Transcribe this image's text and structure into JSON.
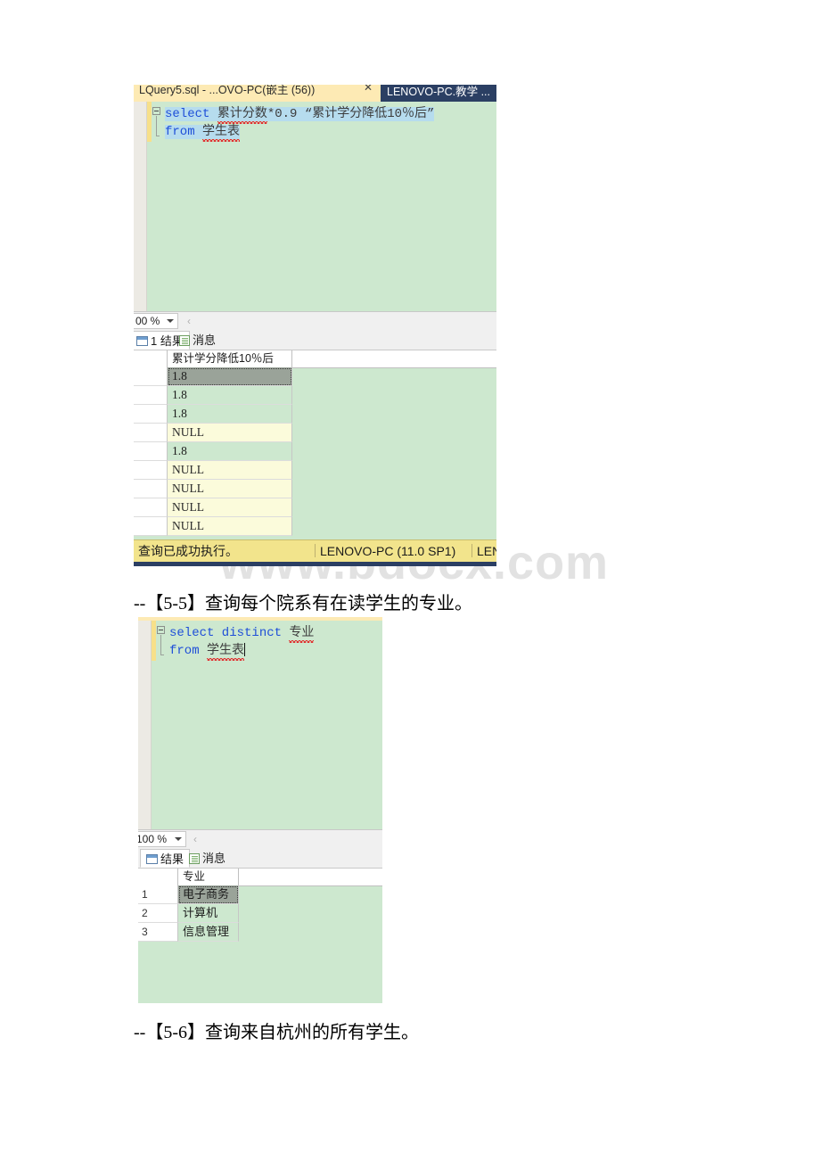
{
  "document": {
    "watermark": "www.bdocx.com",
    "lines": [
      {
        "id": "line-5-5",
        "text": "--【5-5】查询每个院系有在读学生的专业。"
      },
      {
        "id": "line-5-6",
        "text": "--【5-6】查询来自杭州的所有学生。"
      }
    ]
  },
  "panel1": {
    "tabs": {
      "active_label": "LQuery5.sql - ...OVO-PC(嵌主 (56))",
      "close_label": "✕",
      "inactive_label": "LENOVO-PC.教学 ..."
    },
    "editor": {
      "lines": [
        {
          "tokens": [
            {
              "text": "select",
              "type": "keyword"
            },
            {
              "text": " ",
              "type": "plain"
            },
            {
              "text": "累计分数",
              "type": "identifier-cn"
            },
            {
              "text": "*0.9",
              "type": "operator"
            },
            {
              "text": " “累计学分降低10％后”",
              "type": "string"
            }
          ]
        },
        {
          "tokens": [
            {
              "text": "from",
              "type": "keyword"
            },
            {
              "text": " ",
              "type": "plain"
            },
            {
              "text": "学生表",
              "type": "identifier-cn"
            }
          ]
        }
      ]
    },
    "zoombar": {
      "zoom_value": "00 %",
      "chevron": "‹"
    },
    "result_tabs": [
      {
        "label": "1 结果",
        "icon": "grid-icon",
        "active": true
      },
      {
        "label": "消息",
        "icon": "message-icon",
        "active": false
      }
    ],
    "grid": {
      "columns": [
        "",
        "累计学分降低10％后"
      ],
      "rows": [
        {
          "num": "",
          "value": "1.8",
          "style": "selected"
        },
        {
          "num": "",
          "value": "1.8",
          "style": "green"
        },
        {
          "num": "",
          "value": "1.8",
          "style": "green"
        },
        {
          "num": "",
          "value": "NULL",
          "style": "null"
        },
        {
          "num": "",
          "value": "1.8",
          "style": "green"
        },
        {
          "num": "",
          "value": "NULL",
          "style": "null"
        },
        {
          "num": "",
          "value": "NULL",
          "style": "null"
        },
        {
          "num": "",
          "value": "NULL",
          "style": "null"
        },
        {
          "num": "",
          "value": "NULL",
          "style": "null"
        }
      ]
    },
    "status": {
      "message": "查询已成功执行。",
      "server": "LENOVO-PC (11.0 SP1)",
      "user": "LENO"
    }
  },
  "panel2": {
    "editor": {
      "lines": [
        {
          "tokens": [
            {
              "text": "select distinct",
              "type": "keyword"
            },
            {
              "text": " ",
              "type": "plain"
            },
            {
              "text": "专业",
              "type": "identifier-cn"
            }
          ]
        },
        {
          "tokens": [
            {
              "text": "from",
              "type": "keyword"
            },
            {
              "text": " ",
              "type": "plain"
            },
            {
              "text": "学生表",
              "type": "identifier-cn"
            }
          ]
        }
      ]
    },
    "zoombar": {
      "zoom_value": "100 %",
      "chevron": "‹"
    },
    "result_tabs": [
      {
        "label": "结果",
        "icon": "grid-icon",
        "active": true
      },
      {
        "label": "消息",
        "icon": "message-icon",
        "active": false
      }
    ],
    "grid": {
      "columns": [
        "",
        "专业"
      ],
      "rows": [
        {
          "num": "1",
          "value": "电子商务",
          "style": "selected"
        },
        {
          "num": "2",
          "value": "计算机",
          "style": "green"
        },
        {
          "num": "3",
          "value": "信息管理",
          "style": "green"
        }
      ]
    }
  },
  "colors": {
    "editor_bg": "#cde8cf",
    "tab_strip": "#fdeab4",
    "tab_inactive_bg": "#2b3f63",
    "selection": "#b6dcee",
    "keyword": "#1f4fd8",
    "status_bg": "#f2e48c",
    "null_cell": "#fbfbdb",
    "selected_cell": "#9aa399",
    "change_bar": "#f7e08a",
    "watermark": "#e2e2e2"
  }
}
